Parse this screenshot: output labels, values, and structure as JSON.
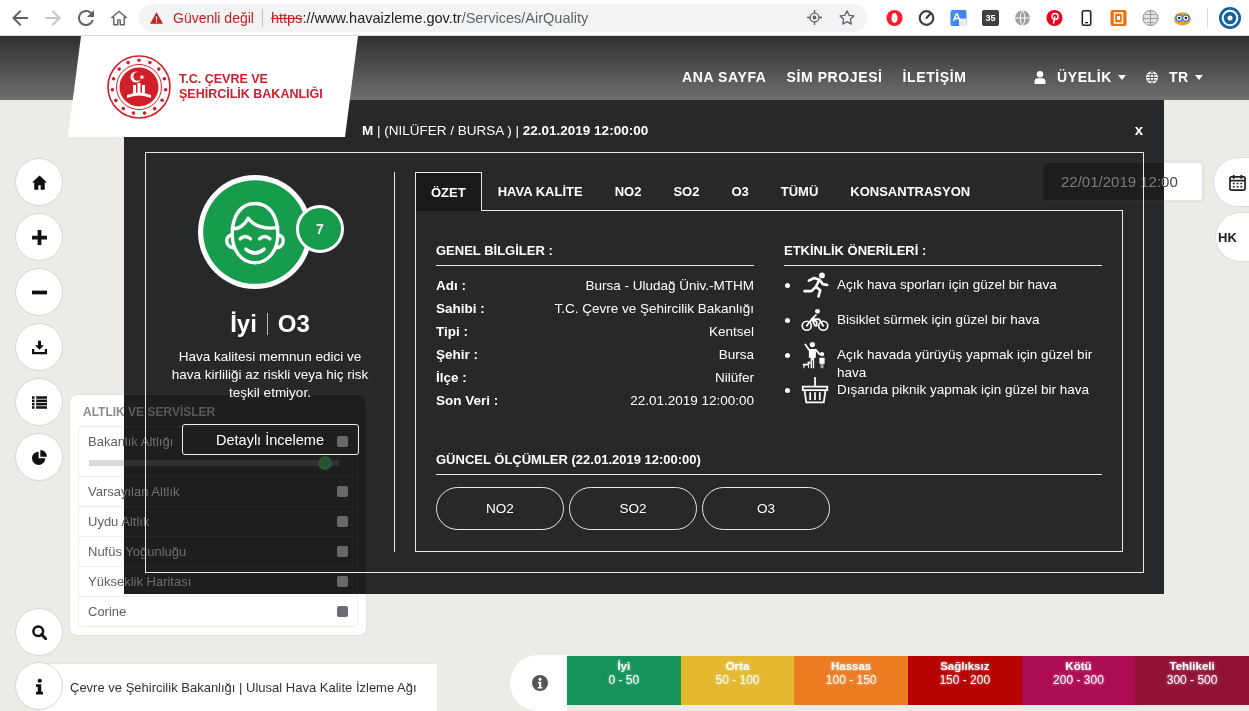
{
  "browser": {
    "forward_disabled": true,
    "secure": false,
    "security_label": "Güvenli değil",
    "url": {
      "scheme": "https",
      "host": "://www.havaizleme.gov.tr",
      "path": "/Services/AirQuality"
    },
    "extension_badge": "35"
  },
  "header": {
    "logo_lines": [
      "T.C. ÇEVRE VE",
      "ŞEHİRCİLİK BAKANLIĞI"
    ],
    "nav": [
      "ANA SAYFA",
      "SİM PROJESİ",
      "İLETİŞİM"
    ],
    "menus": [
      {
        "kind": "account",
        "label": "ÜYELİK"
      },
      {
        "kind": "language",
        "label": "TR"
      }
    ]
  },
  "modal": {
    "title": "**M** | (NILÜFER / BURSA ) | **22.01.2019 12:00:00**",
    "close": "x",
    "summary": {
      "index": "7",
      "status": "İyi",
      "pollutant": "O3",
      "description": "Hava kalitesi memnun edici ve hava kirliliği az riskli veya hiç risk teşkil etmiyor.",
      "button": "Detaylı İnceleme"
    },
    "tabs": [
      {
        "label": "ÖZET",
        "selected": true
      },
      {
        "label": "HAVA KALİTE",
        "selected": false
      },
      {
        "label": "NO2",
        "selected": false
      },
      {
        "label": "SO2",
        "selected": false
      },
      {
        "label": "O3",
        "selected": false
      },
      {
        "label": "TÜMÜ",
        "selected": false
      },
      {
        "label": "KONSANTRASYON",
        "selected": false
      }
    ],
    "general_info": {
      "heading": "GENEL BİLGİLER :",
      "rows": [
        {
          "label": "Adı :",
          "value": "Bursa - Uludağ Üniv.-MTHM"
        },
        {
          "label": "Sahibi :",
          "value": "T.C. Çevre ve Şehircilik Bakanlığı"
        },
        {
          "label": "Tipi :",
          "value": "Kentsel"
        },
        {
          "label": "Şehir :",
          "value": "Bursa"
        },
        {
          "label": "İlçe :",
          "value": "Nilüfer"
        },
        {
          "label": "Son Veri :",
          "value": "22.01.2019 12:00:00"
        }
      ]
    },
    "suggestions": {
      "heading": "ETKİNLİK ÖNERİLERİ :",
      "items": [
        {
          "kind": "running",
          "text": "Açık hava sporları için güzel bir hava"
        },
        {
          "kind": "cycling",
          "text": "Bisiklet sürmek için güzel bir hava"
        },
        {
          "kind": "walking",
          "text": "Açık havada yürüyüş yapmak için güzel bir hava"
        },
        {
          "kind": "picnic",
          "text": "Dışarıda piknik yapmak için güzel bir hava"
        }
      ]
    },
    "measurements": {
      "heading": "GÜNCEL ÖLÇÜMLER (22.01.2019 12:00:00)",
      "buttons": [
        "NO2",
        "SO2",
        "O3"
      ]
    }
  },
  "layers_panel": {
    "title": "ALTLIK VE SERVİSLER",
    "layers": [
      {
        "kind": "slider",
        "label": "Bakanlık Altlığı",
        "checked": false,
        "level": 0.97
      },
      {
        "kind": "toggle",
        "label": "Varsayılan Altlık",
        "checked": false
      },
      {
        "kind": "toggle",
        "label": "Uydu Altlık",
        "checked": false
      },
      {
        "kind": "toggle",
        "label": "Nufüs Yoğunluğu",
        "checked": false
      },
      {
        "kind": "toggle",
        "label": "Yükseklik Haritası",
        "checked": false
      },
      {
        "kind": "toggle",
        "label": "Corine",
        "checked": false
      }
    ]
  },
  "date_picker": {
    "value": "22/01/2019 12:00"
  },
  "map_buttons": {
    "hk": "HK"
  },
  "footer": {
    "text": "Çevre ve Şehircilik Bakanlığı | Ulusal Hava Kalite İzleme Ağı"
  },
  "legend": {
    "items": [
      {
        "label": "İyi",
        "range": "0 - 50",
        "color": "#13925a"
      },
      {
        "label": "Orta",
        "range": "50 - 100",
        "color": "#e4b92f"
      },
      {
        "label": "Hassas",
        "range": "100 - 150",
        "color": "#ec7c22"
      },
      {
        "label": "Sağlıksız",
        "range": "150 - 200",
        "color": "#b70202"
      },
      {
        "label": "Kötü",
        "range": "200 - 300",
        "color": "#ae0c52"
      },
      {
        "label": "Tehlikeli",
        "range": "300 - 500",
        "color": "#921235"
      }
    ]
  }
}
